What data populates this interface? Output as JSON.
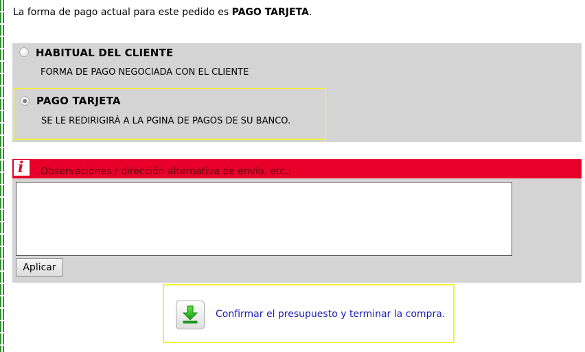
{
  "intro": {
    "prefix": "La forma de pago actual para este pedido es ",
    "current_method": "PAGO TARJETA",
    "suffix": "."
  },
  "payment_options": [
    {
      "title": "HABITUAL DEL CLIENTE",
      "description": "FORMA DE PAGO NEGOCIADA CON EL CLIENTE",
      "selected": false
    },
    {
      "title": "PAGO TARJETA",
      "description": "SE LE REDIRIGIRÁ A LA PGINA DE PAGOS DE SU BANCO.",
      "selected": true
    }
  ],
  "observations": {
    "icon": "info-icon",
    "label": "Observaciones / dirección alternativa de envío, etc.:",
    "value": "",
    "apply_label": "Aplicar"
  },
  "confirm": {
    "icon": "download-arrow-icon",
    "label": "Confirmar el presupuesto y terminar la compra."
  },
  "colors": {
    "panel_bg": "#d4d4d4",
    "highlight_border": "#f2ef3a",
    "header_red": "#e8002a",
    "link_blue": "#1a1ab8",
    "left_border_green": "#2e8b2e"
  }
}
